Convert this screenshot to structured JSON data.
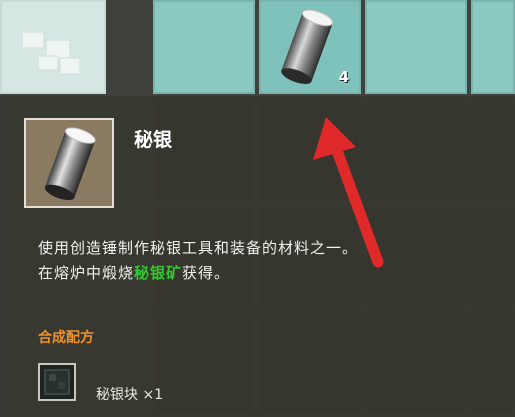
{
  "inventory": {
    "active_slot_count": "4"
  },
  "tooltip": {
    "item_name": "秘银",
    "description_line1": "使用创造锤制作秘银工具和装备的材料之一。",
    "description_line2_prefix": "在熔炉中煅烧",
    "description_highlight": "秘银矿",
    "description_line2_suffix": "获得。",
    "recipe_header": "合成配方",
    "recipe_item": "秘银块 ×1"
  },
  "icons": {
    "item_icon": "mithril-ingot-icon",
    "recipe_icon": "mithril-block-icon",
    "arrow": "red-arrow-annotation"
  },
  "colors": {
    "highlight": "#35c832",
    "recipe_header": "#f0922c",
    "arrow": "#e02a2a"
  }
}
